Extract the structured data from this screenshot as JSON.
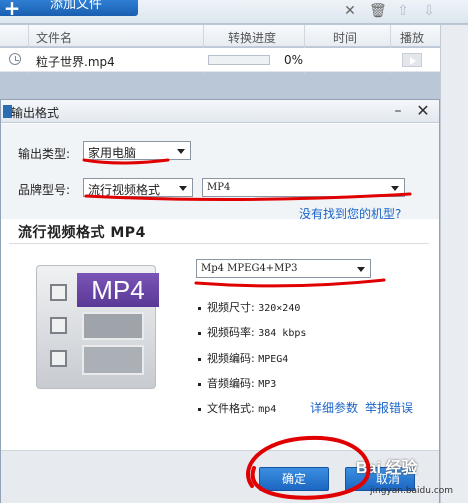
{
  "toolbar": {
    "add_file_label": "添加文件",
    "icons": [
      "close-icon",
      "trash-icon",
      "arrow-up-icon",
      "arrow-down-icon"
    ]
  },
  "file_list": {
    "columns": [
      "文件名",
      "转换进度",
      "时间",
      "播放"
    ],
    "rows": [
      {
        "file_name": "粒子世界.mp4",
        "progress_pct": 0,
        "progress_text": "0%",
        "time": ""
      }
    ]
  },
  "dialog": {
    "title": "输出格式",
    "output_type_label": "输出类型:",
    "output_type_value": "家用电脑",
    "brand_label": "品牌型号:",
    "brand_value": "流行视频格式",
    "model_value": "MP4",
    "missing_model_link": "没有找到您的机型?",
    "section_title": "流行视频格式 MP4",
    "badge_text": "MP4",
    "codec_value": "Mp4 MPEG4+MP3",
    "specs": [
      {
        "label": "视频尺寸:",
        "value": "320×240"
      },
      {
        "label": "视频码率:",
        "value": "384 kbps"
      },
      {
        "label": "视频编码:",
        "value": "MPEG4"
      },
      {
        "label": "音频编码:",
        "value": "MP3"
      },
      {
        "label": "文件格式:",
        "value": "mp4"
      }
    ],
    "detail_link": "详细参数",
    "report_link": "举报错误",
    "ok_label": "确定",
    "cancel_label": "取消"
  },
  "watermark": {
    "text": "Bai 经验",
    "sub": "jingyan.baidu.com"
  },
  "colors": {
    "accent": "#1c66c2",
    "annotation": "#e00000",
    "badge": "#5a3996"
  }
}
